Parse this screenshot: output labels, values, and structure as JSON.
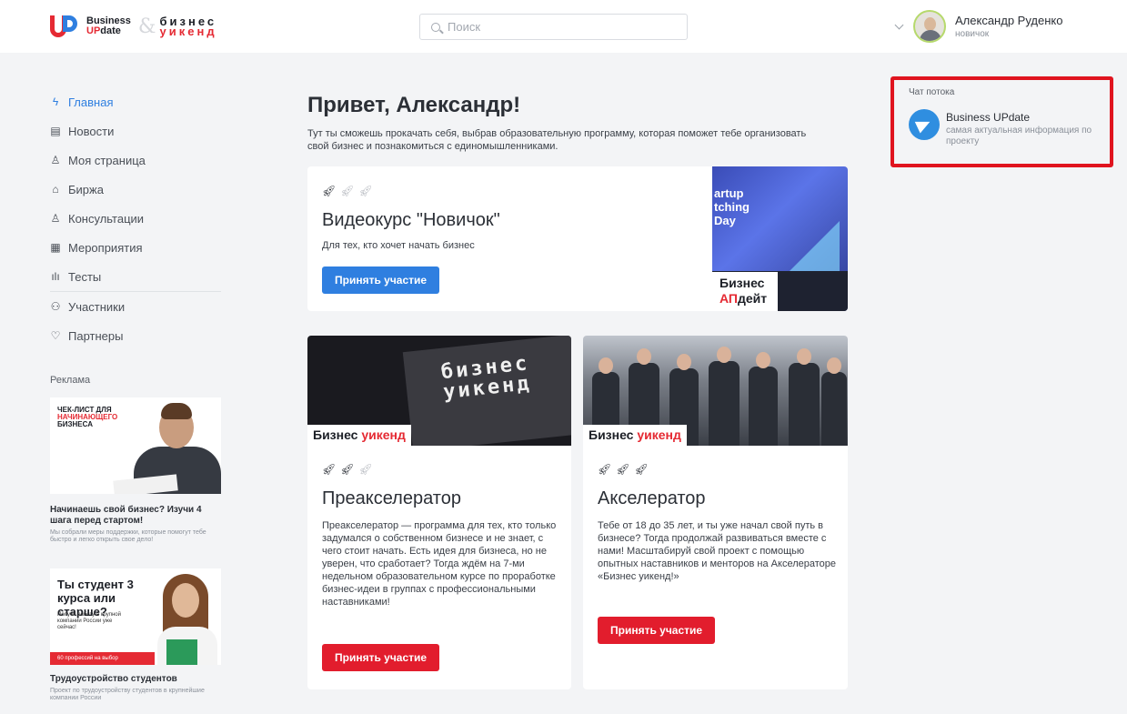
{
  "header": {
    "logo": {
      "brand_line1": "Business",
      "brand_line2_up": "UP",
      "brand_line2_rest": "date",
      "amp": "&",
      "weekend_line1": "бизнес",
      "weekend_line2": "уикенд"
    },
    "search": {
      "placeholder": "Поиск"
    },
    "user": {
      "name": "Александр Руденко",
      "status": "новичок"
    }
  },
  "sidebar": {
    "items": [
      {
        "label": "Главная",
        "icon": "lightning-icon",
        "active": true
      },
      {
        "label": "Новости",
        "icon": "news-icon"
      },
      {
        "label": "Моя страница",
        "icon": "user-icon"
      },
      {
        "label": "Биржа",
        "icon": "exchange-icon"
      },
      {
        "label": "Консультации",
        "icon": "consultation-icon"
      },
      {
        "label": "Мероприятия",
        "icon": "calendar-icon"
      },
      {
        "label": "Тесты",
        "icon": "bar-chart-icon"
      },
      {
        "label": "Участники",
        "icon": "users-icon"
      },
      {
        "label": "Партнеры",
        "icon": "partner-icon"
      }
    ],
    "ads": {
      "title": "Реклама",
      "ad1": {
        "banner_line1": "ЧЕК-ЛИСТ ДЛЯ",
        "banner_line2": "НАЧИНАЮЩЕГО",
        "banner_line3": "БИЗНЕСА",
        "title": "Начинаешь свой бизнес? Изучи 4 шага перед стартом!",
        "subtitle": "Мы собрали меры поддержки, которые помогут тебе быстро и легко открыть свое дело!"
      },
      "ad2": {
        "banner_title": "Ты студент 3 курса или старше?",
        "banner_sub": "Получи работу в крупной компании России уже сейчас!",
        "banner_bar": "60 профессий на выбор",
        "title": "Трудоустройство студентов",
        "subtitle": "Проект по трудоустройству студентов в крупнейшие компании России"
      }
    }
  },
  "main": {
    "greeting": "Привет, Александр!",
    "intro": "Тут ты сможешь прокачать себя, выбрав образовательную программу, которая поможет тебе организовать свой бизнес и познакомиться с единомышленниками.",
    "cards": [
      {
        "title": "Видеокурс \"Новичок\"",
        "text": "Для тех, кто хочет начать бизнес",
        "button": "Принять участие",
        "rockets_filled": 1,
        "rockets_total": 3,
        "image_text": "artup tching Day",
        "image_label_line1": "Бизнес",
        "image_label_red": "АП",
        "image_label_rest": "дейт"
      },
      {
        "title": "Преакселератор",
        "text": "Преакселератор — программа для тех, кто только задумался о собственном бизнесе и не знает, с чего стоит начать. Есть идея для бизнеса, но не уверен, что сработает? Тогда ждём на 7-ми недельном образовательном курсе по проработке бизнес-идеи в группах с профессиональными наставниками!",
        "button": "Принять участие",
        "rockets_filled": 2,
        "rockets_total": 3,
        "image_screen_text": "бизнес уикенд",
        "image_label": "Бизнес",
        "image_label_red": "уикенд"
      },
      {
        "title": "Акселератор",
        "text": "Тебе от 18 до 35 лет, и ты уже начал свой путь в бизнесе? Тогда продолжай развиваться вместе с нами! Масштабируй свой проект с помощью опытных наставников и менторов на Акселераторе «Бизнес уикенд!»",
        "button": "Принять участие",
        "rockets_filled": 3,
        "rockets_total": 3,
        "image_label": "Бизнес",
        "image_label_red": "уикенд"
      }
    ]
  },
  "chat": {
    "title": "Чат потока",
    "name": "Business UPdate",
    "description": "самая актуальная информация по проекту",
    "icon": "telegram-icon"
  },
  "colors": {
    "accent": "#2f7fe0",
    "brand_red": "#e52a33",
    "highlight_frame": "#e0141f"
  }
}
